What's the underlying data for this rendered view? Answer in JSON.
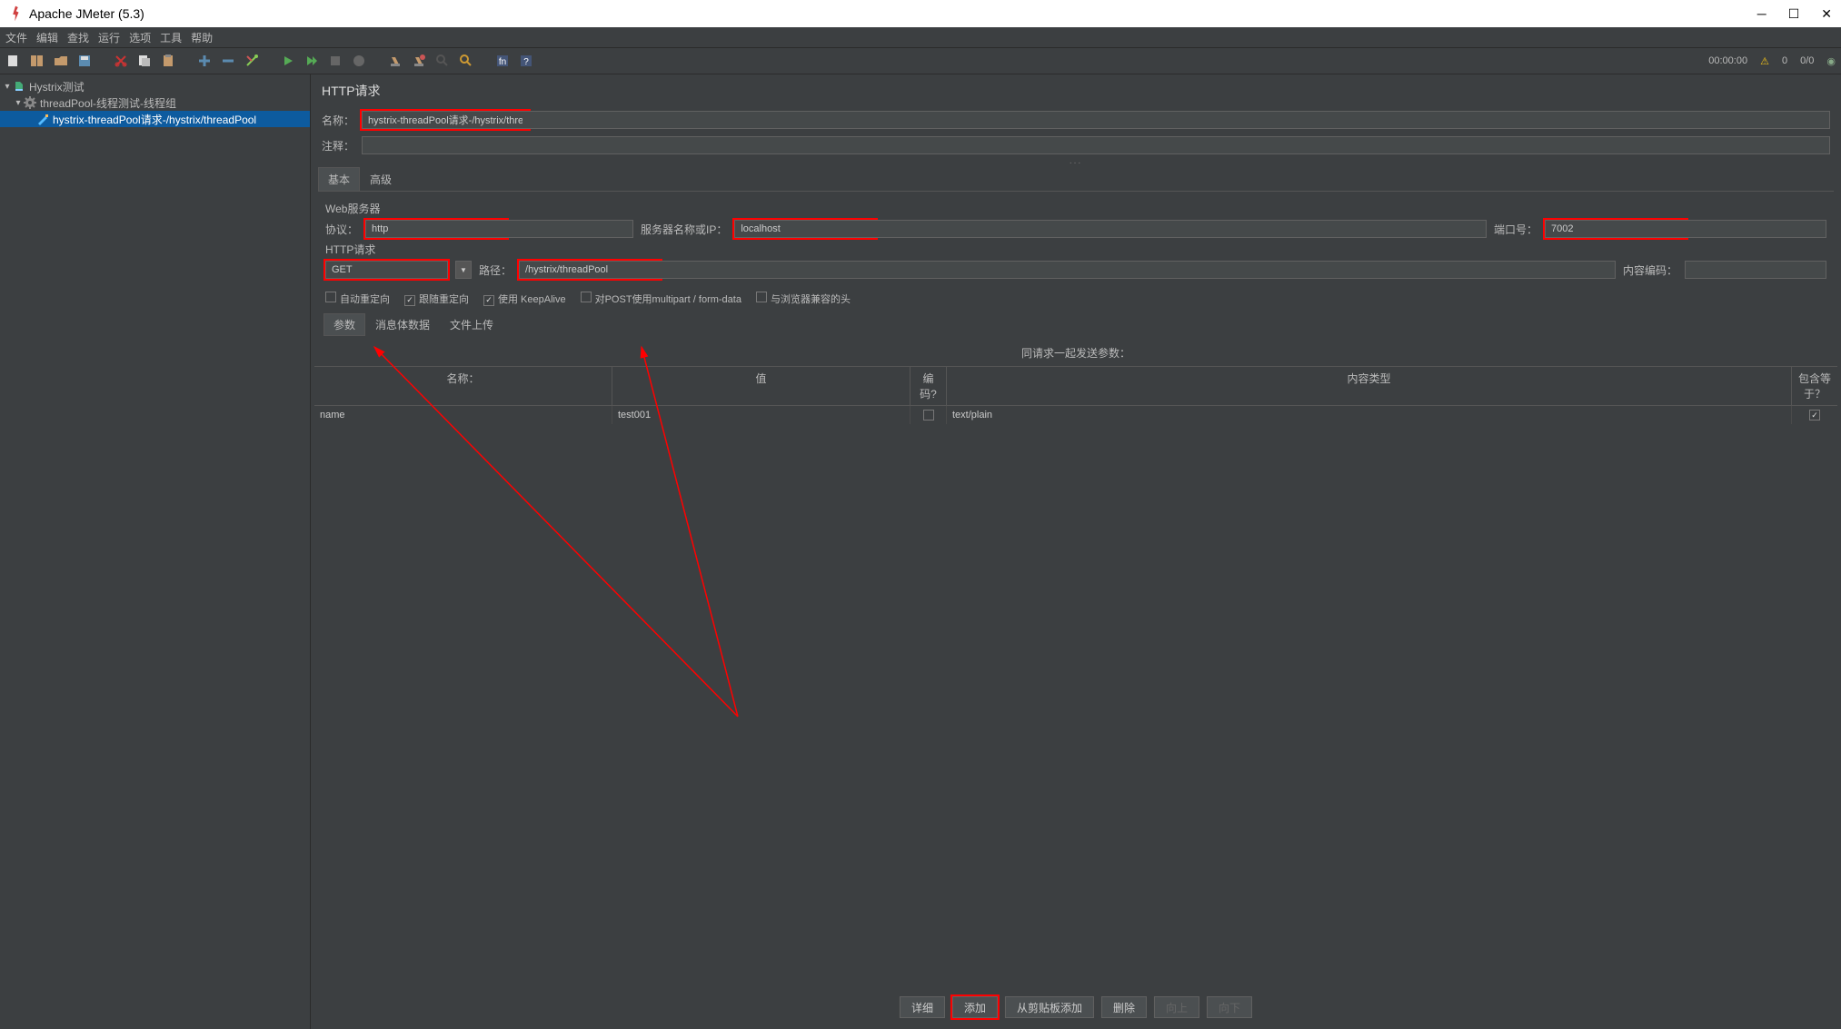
{
  "window": {
    "title": "Apache JMeter (5.3)"
  },
  "menu": [
    "文件",
    "编辑",
    "查找",
    "运行",
    "选项",
    "工具",
    "帮助"
  ],
  "status": {
    "time": "00:00:00",
    "warn_count": "0",
    "thread_ratio": "0/0"
  },
  "tree": {
    "root": "Hystrix测试",
    "group": "threadPool-线程测试-线程组",
    "sampler": "hystrix-threadPool请求-/hystrix/threadPool"
  },
  "panel": {
    "title": "HTTP请求",
    "name_label": "名称：",
    "name_value": "hystrix-threadPool请求-/hystrix/threadPool",
    "comment_label": "注释：",
    "comment_value": ""
  },
  "tabs": {
    "basic": "基本",
    "advanced": "高级"
  },
  "web": {
    "section": "Web服务器",
    "protocol_label": "协议：",
    "protocol": "http",
    "server_label": "服务器名称或IP：",
    "server": "localhost",
    "port_label": "端口号：",
    "port": "7002"
  },
  "http": {
    "section": "HTTP请求",
    "method": "GET",
    "path_label": "路径：",
    "path": "/hystrix/threadPool",
    "encoding_label": "内容编码：",
    "encoding": ""
  },
  "options": {
    "auto_redirect": "自动重定向",
    "follow_redirect": "跟随重定向",
    "keepalive": "使用 KeepAlive",
    "multipart": "对POST使用multipart / form-data",
    "browser_headers": "与浏览器兼容的头"
  },
  "subtabs": {
    "params": "参数",
    "body": "消息体数据",
    "files": "文件上传"
  },
  "grid": {
    "caption": "同请求一起发送参数：",
    "headers": {
      "name": "名称：",
      "value": "值",
      "encode": "编码?",
      "type": "内容类型",
      "include": "包含等于？"
    },
    "row": {
      "name": "name",
      "value": "test001",
      "encode": false,
      "type": "text/plain",
      "include": true
    }
  },
  "buttons": {
    "detail": "详细",
    "add": "添加",
    "clipboard": "从剪贴板添加",
    "delete": "删除",
    "up": "向上",
    "down": "向下"
  }
}
